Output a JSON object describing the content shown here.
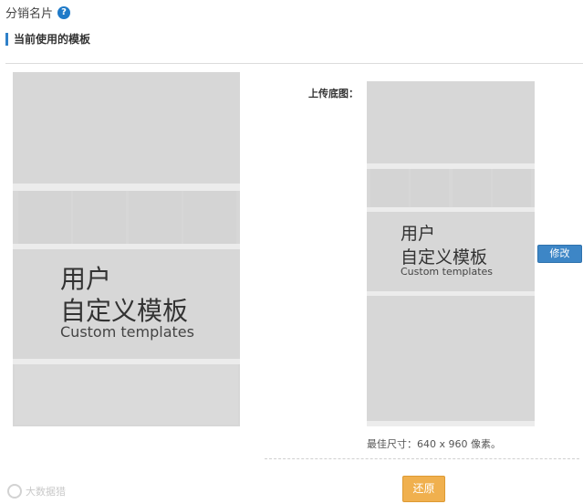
{
  "header": {
    "title": "分销名片",
    "help_icon": "?"
  },
  "section": {
    "title": "当前使用的模板"
  },
  "template": {
    "line1": "用户",
    "line2": "自定义模板",
    "line3": "Custom templates"
  },
  "upload": {
    "label": "上传底图："
  },
  "buttons": {
    "modify": "修改",
    "restore": "还原"
  },
  "size_hint": "最佳尺寸：640 x 960 像素。",
  "watermark": "大数据猎",
  "colors": {
    "accent": "#2f80c8",
    "modify_button": "#3d86c6",
    "restore_button": "#f0b04e",
    "placeholder": "#d7d7d7"
  }
}
